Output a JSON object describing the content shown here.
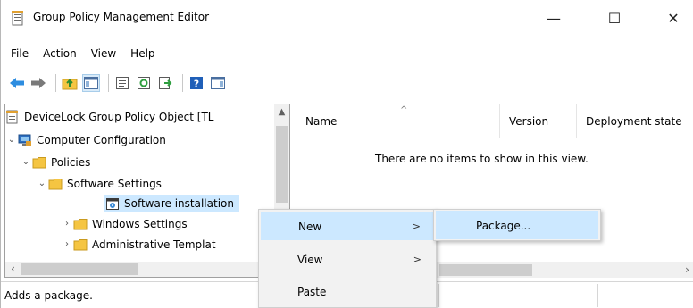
{
  "window": {
    "title": "Group Policy Management Editor",
    "controls": {
      "minimize": "—",
      "maximize": "☐",
      "close": "✕"
    }
  },
  "menubar": [
    "File",
    "Action",
    "View",
    "Help"
  ],
  "toolbar": {
    "icons": [
      "back-icon",
      "forward-icon",
      "up-folder-icon",
      "show-hide-tree-icon",
      "properties-icon",
      "refresh-icon",
      "export-list-icon",
      "help-icon",
      "show-hide-action-pane-icon"
    ]
  },
  "tree": {
    "items": [
      {
        "label": "DeviceLock Group Policy Object [TL",
        "expander": "",
        "icon": "policy-object-icon"
      },
      {
        "label": "Computer Configuration",
        "expander": "⌄",
        "icon": "computer-icon"
      },
      {
        "label": "Policies",
        "expander": "⌄",
        "icon": "folder-icon"
      },
      {
        "label": "Software Settings",
        "expander": "⌄",
        "icon": "folder-icon"
      },
      {
        "label": "Software installation",
        "expander": "",
        "icon": "software-installation-icon",
        "selected": true
      },
      {
        "label": "Windows Settings",
        "expander": "›",
        "icon": "folder-icon"
      },
      {
        "label": "Administrative Templat",
        "expander": "›",
        "icon": "folder-icon"
      }
    ]
  },
  "list": {
    "columns": [
      "Name",
      "Version",
      "Deployment state"
    ],
    "empty_message": "There are no items to show in this view."
  },
  "context_menu": {
    "items": [
      {
        "label": "New",
        "submenu": true,
        "highlighted": true
      },
      {
        "label": "View",
        "submenu": true,
        "highlighted": false
      },
      {
        "label": "Paste",
        "submenu": false,
        "highlighted": false
      }
    ],
    "submenu": {
      "items": [
        {
          "label": "Package...",
          "highlighted": true
        }
      ]
    }
  },
  "statusbar": {
    "text": "Adds a package."
  },
  "colors": {
    "selection": "#cce8ff",
    "menu_bg": "#f2f2f2",
    "folder": "#f5c542"
  }
}
